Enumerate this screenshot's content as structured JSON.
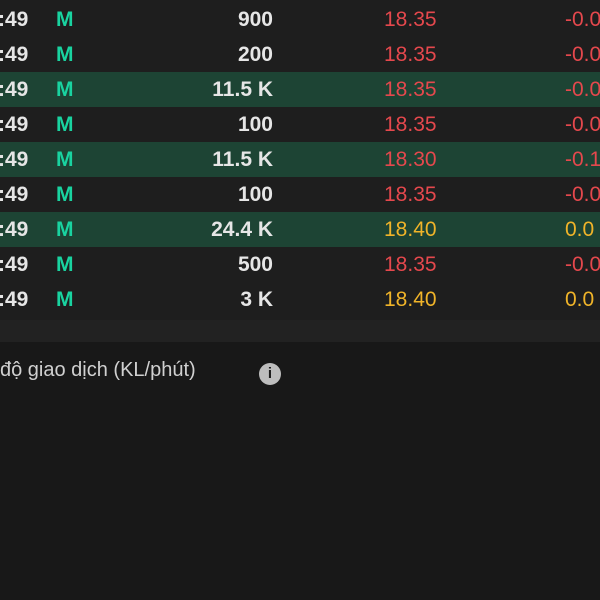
{
  "trades": [
    {
      "time": ":49",
      "side": "M",
      "volume": "900",
      "price": "18.35",
      "price_color": "red",
      "change": "-0.0",
      "highlight": false
    },
    {
      "time": ":49",
      "side": "M",
      "volume": "200",
      "price": "18.35",
      "price_color": "red",
      "change": "-0.0",
      "highlight": false
    },
    {
      "time": ":49",
      "side": "M",
      "volume": "11.5 K",
      "price": "18.35",
      "price_color": "red",
      "change": "-0.0",
      "highlight": true
    },
    {
      "time": ":49",
      "side": "M",
      "volume": "100",
      "price": "18.35",
      "price_color": "red",
      "change": "-0.0",
      "highlight": false
    },
    {
      "time": ":49",
      "side": "M",
      "volume": "11.5 K",
      "price": "18.30",
      "price_color": "red",
      "change": "-0.1",
      "highlight": true
    },
    {
      "time": ":49",
      "side": "M",
      "volume": "100",
      "price": "18.35",
      "price_color": "red",
      "change": "-0.0",
      "highlight": false
    },
    {
      "time": ":49",
      "side": "M",
      "volume": "24.4 K",
      "price": "18.40",
      "price_color": "yellow",
      "change": "0.0",
      "highlight": true
    },
    {
      "time": ":49",
      "side": "M",
      "volume": "500",
      "price": "18.35",
      "price_color": "red",
      "change": "-0.0",
      "highlight": false
    },
    {
      "time": ":49",
      "side": "M",
      "volume": "3 K",
      "price": "18.40",
      "price_color": "yellow",
      "change": "0.0",
      "highlight": false
    }
  ],
  "volume_section": {
    "title": "độ giao dịch (KL/phút)",
    "info_icon": "info-icon"
  },
  "colors": {
    "buy": "#19d3a0",
    "down": "#e5484d",
    "up": "#f0b429",
    "highlight_row": "#1d4434",
    "volume_bar": "#14b88a",
    "avg_line": "#f0b429"
  },
  "chart_data": {
    "type": "bar",
    "title": "độ giao dịch (KL/phút)",
    "xlabel": "",
    "ylabel": "",
    "series": [
      {
        "values": [
          0,
          0,
          0,
          0,
          0,
          0,
          0,
          0,
          0,
          0,
          0,
          0,
          0,
          0,
          0,
          0,
          0,
          0,
          0,
          0,
          0,
          0,
          0,
          0,
          0,
          0,
          0,
          0,
          0,
          0,
          0,
          0,
          0,
          0,
          0,
          0,
          0,
          0,
          0,
          0,
          0,
          0,
          0,
          0,
          0,
          0,
          0,
          0,
          0,
          0,
          0,
          0,
          0,
          0,
          0,
          0,
          0,
          0,
          0,
          0,
          0,
          0,
          0,
          0,
          0,
          0,
          0,
          0,
          0,
          0,
          0,
          0,
          0,
          0,
          0,
          0,
          0,
          0,
          0,
          0,
          0,
          0,
          0,
          0,
          0,
          0,
          0,
          0,
          0,
          0,
          0,
          0,
          0,
          0,
          0,
          0,
          0,
          0,
          0,
          0
        ]
      },
      {
        "values": [
          0,
          0,
          0,
          0,
          0,
          0,
          0,
          0,
          0,
          0,
          0,
          0,
          0,
          0,
          0,
          0,
          0,
          0,
          0,
          0,
          0,
          0,
          0,
          0,
          0,
          0,
          0,
          0,
          0,
          0,
          0,
          0,
          0,
          0,
          0,
          0,
          0,
          0,
          0,
          0,
          0,
          0,
          0,
          0,
          0,
          0,
          0,
          0,
          0,
          0,
          0,
          0,
          0,
          0,
          0,
          0,
          0,
          0,
          0,
          0,
          0,
          0,
          0,
          0,
          0,
          0,
          0,
          0,
          0,
          0,
          0,
          0,
          0,
          0,
          0,
          0,
          0,
          0,
          0,
          0,
          0,
          0,
          0,
          0,
          0,
          0,
          0,
          0,
          0,
          0,
          0,
          0,
          0,
          0,
          0,
          0,
          0,
          0,
          0,
          0
        ]
      }
    ]
  }
}
